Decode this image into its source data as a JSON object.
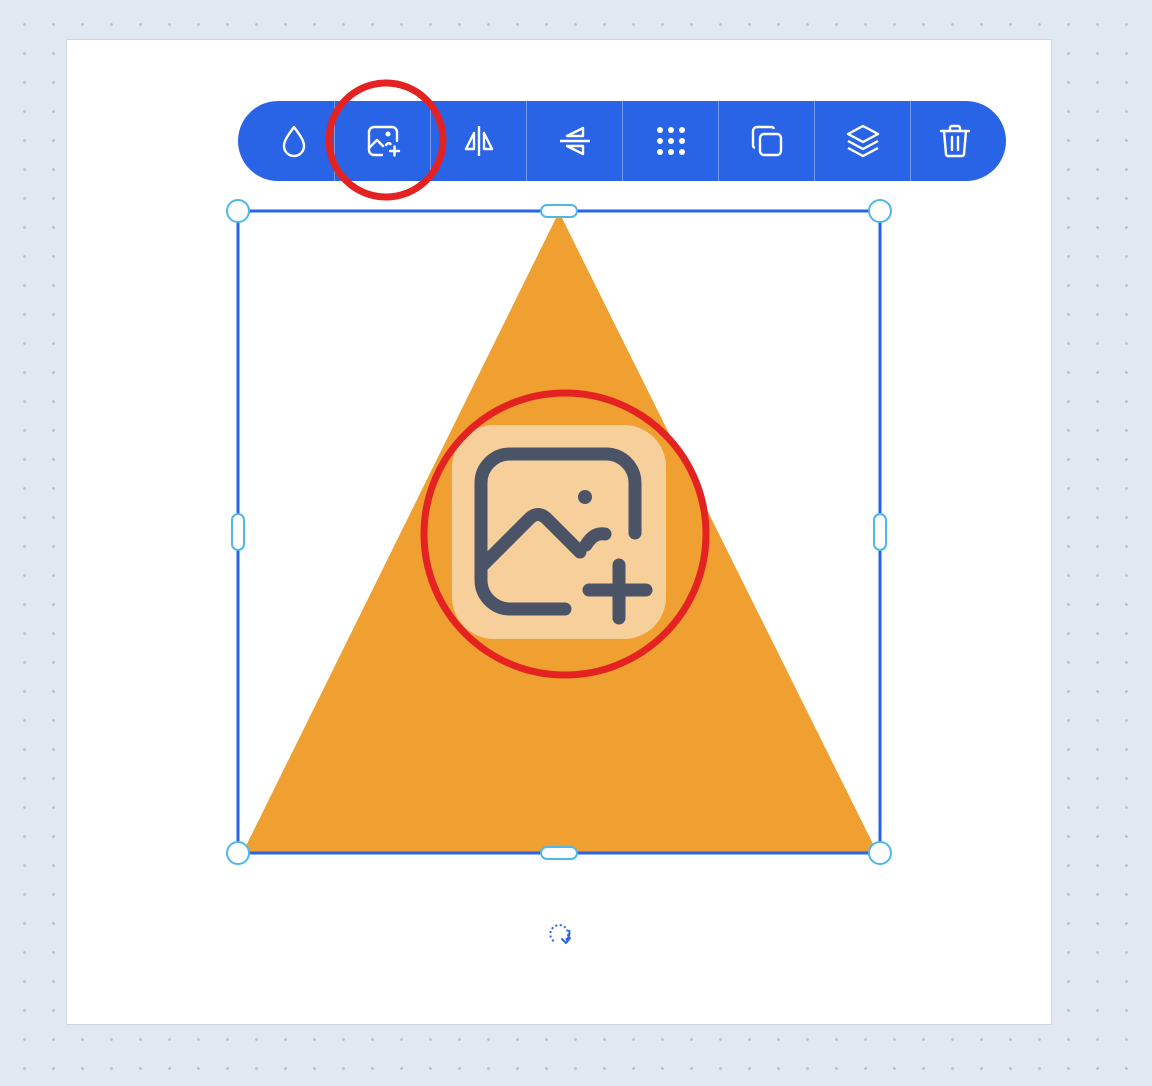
{
  "toolbar": {
    "background": "#2a64e6",
    "buttons": [
      {
        "name": "fill-color-button",
        "icon": "droplet-icon"
      },
      {
        "name": "add-image-button",
        "icon": "image-plus-icon",
        "highlighted": true
      },
      {
        "name": "flip-horizontal-button",
        "icon": "flip-horizontal-icon"
      },
      {
        "name": "flip-vertical-button",
        "icon": "flip-vertical-icon"
      },
      {
        "name": "grid-pattern-button",
        "icon": "dots-grid-icon"
      },
      {
        "name": "duplicate-button",
        "icon": "copy-icon"
      },
      {
        "name": "layers-button",
        "icon": "layers-icon"
      },
      {
        "name": "delete-button",
        "icon": "trash-icon"
      }
    ]
  },
  "shape": {
    "type": "triangle",
    "fill": "#f0a030",
    "placeholder_icon": "image-plus-icon",
    "placeholder_bg": "#f7cf9a"
  },
  "selection": {
    "stroke": "#2a64e6",
    "handle_stroke": "#4fb8e8",
    "rotate_icon": "rotate-icon"
  },
  "annotations": {
    "highlight_color": "#e52222"
  }
}
